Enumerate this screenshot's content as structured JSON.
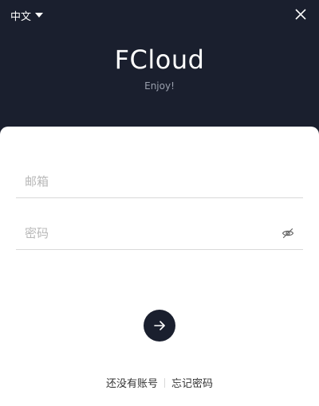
{
  "header": {
    "language": "中文",
    "brand": "FCloud",
    "tagline": "Enjoy!"
  },
  "form": {
    "email_placeholder": "邮箱",
    "email_value": "",
    "password_placeholder": "密码",
    "password_value": ""
  },
  "links": {
    "register": "还没有账号",
    "forgot_password": "忘记密码"
  },
  "icons": {
    "language_caret": "caret-down-icon",
    "close": "close-icon",
    "password_toggle": "eye-off-icon",
    "submit": "arrow-right-icon"
  },
  "colors": {
    "header_background": "#1a1f2e",
    "card_background": "#ffffff",
    "submit_button": "#1a1f2e",
    "tagline_text": "#9aa0ad",
    "placeholder_text": "#b8b8b8",
    "divider": "#d9d9d9"
  }
}
